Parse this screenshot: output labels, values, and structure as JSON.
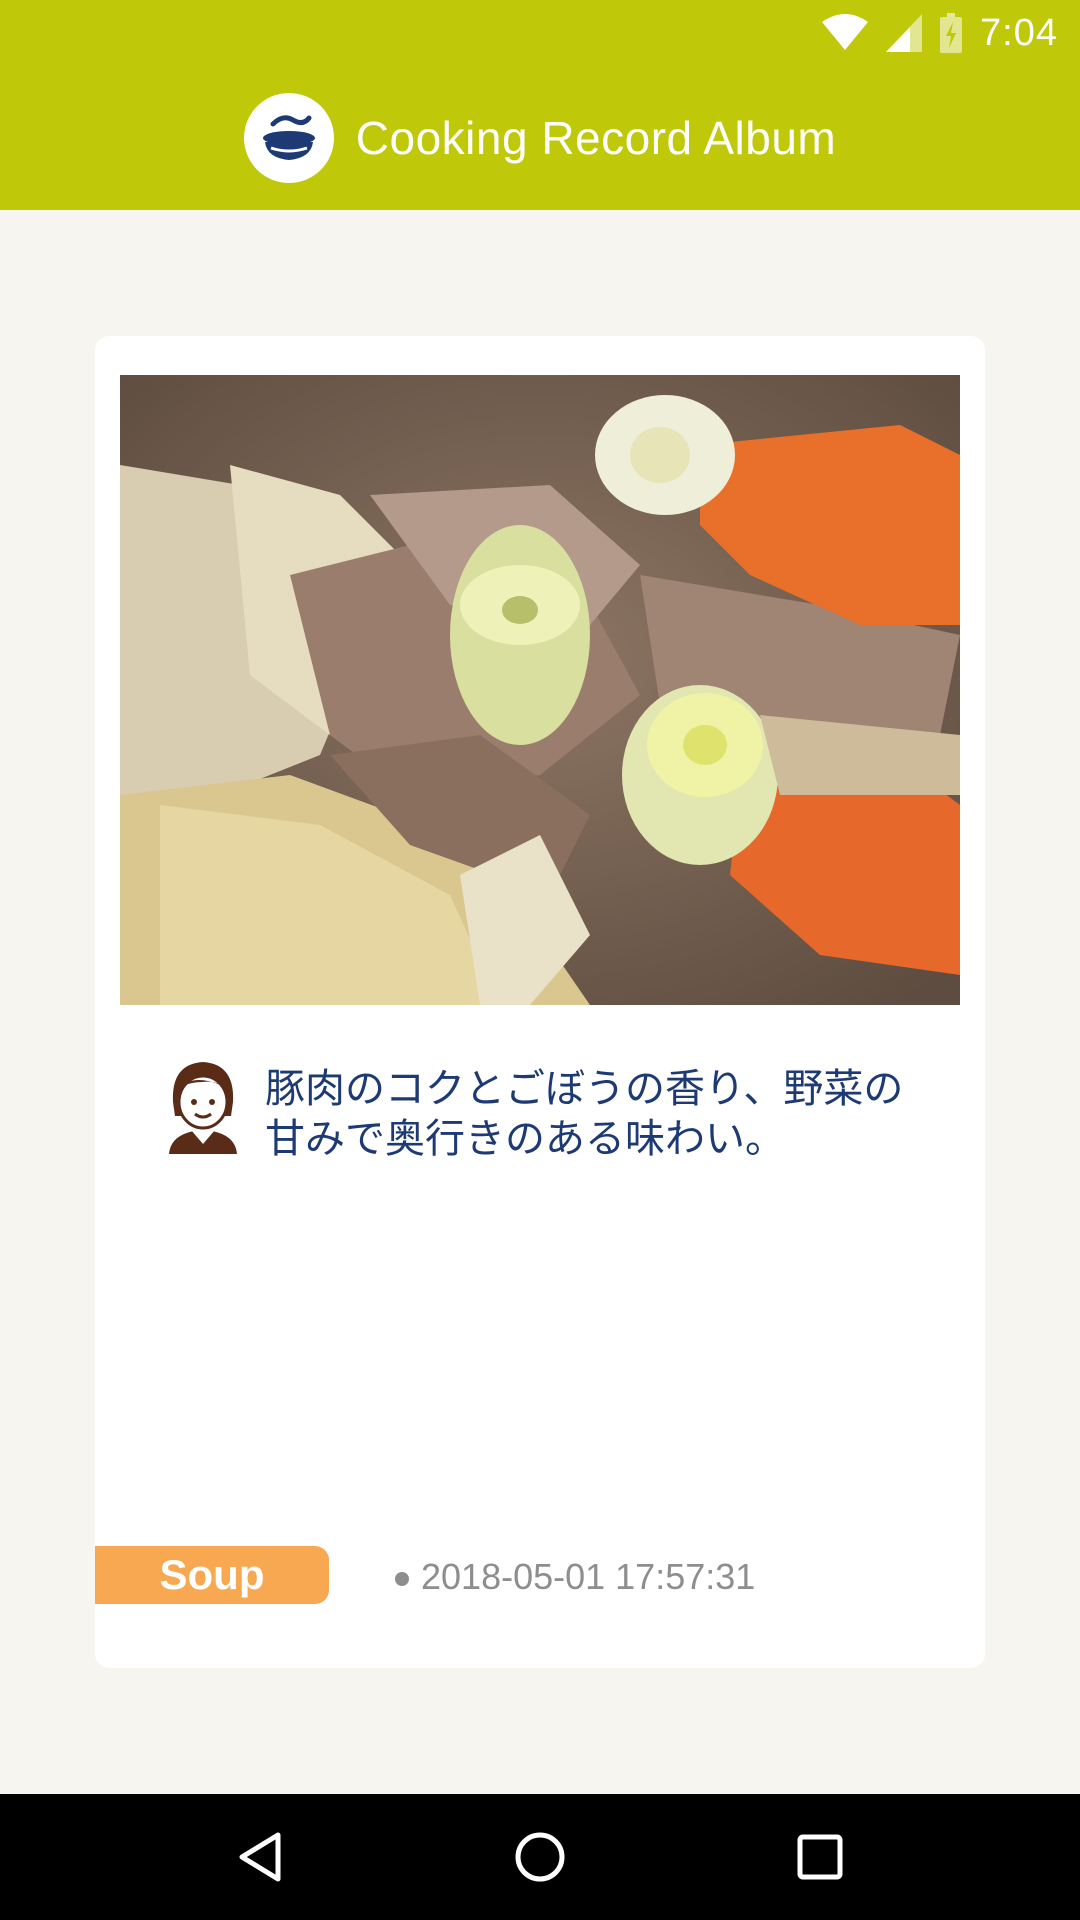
{
  "status_bar": {
    "time": "7:04",
    "icons": [
      "wifi-icon",
      "cell-signal-icon",
      "battery-charging-icon"
    ]
  },
  "app_bar": {
    "title": "Cooking Record Album",
    "logo_icon": "pot-logo-icon",
    "background": "#c0c80a"
  },
  "record": {
    "photo_alt": "nikujaga-photo",
    "comment": "豚肉のコクとごぼうの香り、野菜の甘みで奥行きのある味わい。",
    "category": "Soup",
    "category_color": "#f7a850",
    "timestamp": "2018-05-01 17:57:31",
    "comment_color": "#1d3a75"
  },
  "nav_bar": {
    "buttons": [
      "back-icon",
      "home-icon",
      "recents-icon"
    ]
  }
}
